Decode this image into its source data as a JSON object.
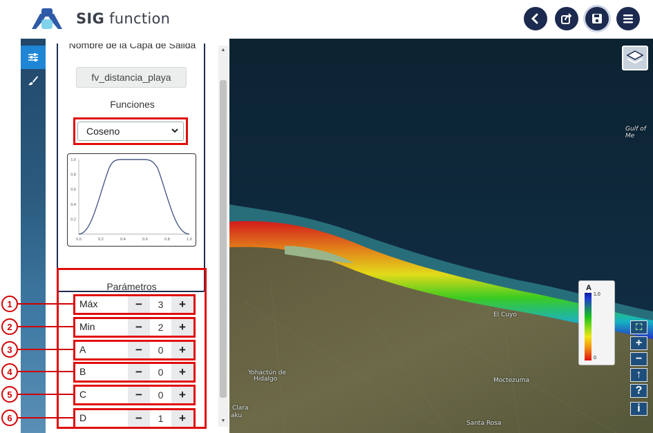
{
  "app": {
    "title_bold": "SIG",
    "title_rest": "function"
  },
  "toolbar": {
    "buttons": [
      {
        "name": "back-button",
        "icon": "chevron-left-icon"
      },
      {
        "name": "share-button",
        "icon": "share-icon"
      },
      {
        "name": "save-button",
        "icon": "save-icon"
      },
      {
        "name": "menu-button",
        "icon": "hamburger-menu-icon"
      }
    ]
  },
  "sidebar": {
    "items": [
      {
        "name": "settings-tab",
        "icon": "sliders-icon",
        "active": true
      },
      {
        "name": "style-tab",
        "icon": "paintbrush-icon",
        "active": false
      }
    ]
  },
  "panel": {
    "output_layer_label": "Nombre de la Capa de Salida",
    "output_layer_value": "fv_distancia_playa",
    "functions_label": "Funciones",
    "function_selected": "Coseno",
    "graph": {
      "x_ticks": [
        "0.0",
        "0.2",
        "0.4",
        "0.6",
        "0.8",
        "1.0"
      ],
      "y_ticks": [
        "0.2",
        "0.4",
        "0.6",
        "0.8",
        "1.0"
      ],
      "curve_color": "#4a5a8a"
    },
    "parameters_title": "Parámetros",
    "parameters": [
      {
        "callout": "1",
        "name": "Máx",
        "value": "3"
      },
      {
        "callout": "2",
        "name": "Min",
        "value": "2"
      },
      {
        "callout": "3",
        "name": "A",
        "value": "0"
      },
      {
        "callout": "4",
        "name": "B",
        "value": "0"
      },
      {
        "callout": "5",
        "name": "C",
        "value": "0"
      },
      {
        "callout": "6",
        "name": "D",
        "value": "1"
      }
    ],
    "minus_symbol": "−",
    "plus_symbol": "+"
  },
  "map": {
    "labels": [
      {
        "text": "Gulf of Me"
      },
      {
        "text": "El Cuyo"
      },
      {
        "text": "Yohactún de"
      },
      {
        "text": "Hidalgo"
      },
      {
        "text": "Moctezuma"
      },
      {
        "text": "Clara"
      },
      {
        "text": "aku"
      },
      {
        "text": "Santa Rosa"
      }
    ],
    "legend": {
      "title": "A",
      "max": "1.0",
      "min": "0"
    },
    "controls": [
      {
        "name": "fullscreen-button",
        "icon": "fullscreen-icon",
        "glyph": "⛶"
      },
      {
        "name": "zoom-in-button",
        "icon": "plus-icon",
        "glyph": "+"
      },
      {
        "name": "zoom-out-button",
        "icon": "minus-icon",
        "glyph": "−"
      },
      {
        "name": "north-button",
        "icon": "arrow-up-icon",
        "glyph": "↑"
      },
      {
        "name": "help-button",
        "icon": "question-icon",
        "glyph": "?"
      },
      {
        "name": "info-button",
        "icon": "info-icon",
        "glyph": "i"
      }
    ]
  },
  "colors": {
    "accent_red": "#e10c0c",
    "navy": "#1b2a4e",
    "active_blue": "#1f86d6"
  }
}
